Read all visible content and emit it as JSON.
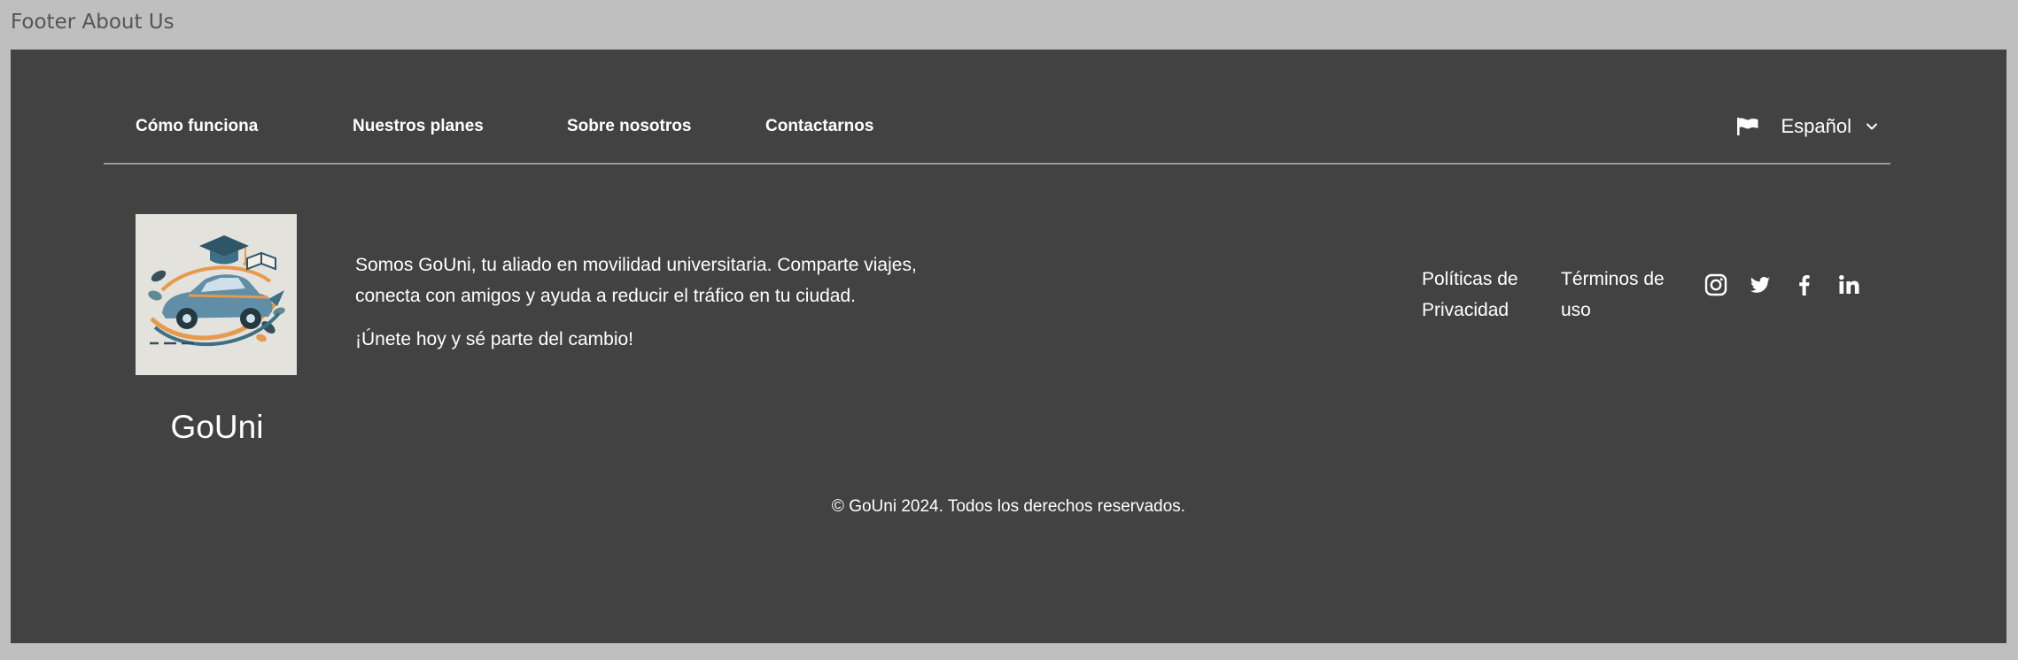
{
  "canvas": {
    "title": "Footer About Us"
  },
  "nav": {
    "items": [
      {
        "label": "Cómo funciona"
      },
      {
        "label": "Nuestros planes"
      },
      {
        "label": "Sobre nosotros"
      },
      {
        "label": "Contactarnos"
      }
    ],
    "language": {
      "icon": "flag-icon",
      "label": "Español",
      "chevron": "chevron-down-icon"
    }
  },
  "brand": {
    "name": "GoUni",
    "logo": "car-graduation-cap-logo"
  },
  "about": {
    "text": "Somos GoUni, tu aliado en movilidad universitaria. Comparte viajes, conecta con amigos y ayuda a reducir el tráfico en tu ciudad.",
    "cta": "¡Únete hoy y sé parte del cambio!"
  },
  "legal": {
    "privacy": "Políticas de Privacidad",
    "terms": "Términos de uso"
  },
  "social": [
    {
      "icon": "instagram-icon"
    },
    {
      "icon": "twitter-icon"
    },
    {
      "icon": "facebook-icon"
    },
    {
      "icon": "linkedin-icon"
    }
  ],
  "copyright": "© GoUni 2024. Todos los derechos reservados.",
  "colors": {
    "page_background": "#bfbfbf",
    "footer_background": "#424242",
    "divider": "#9a9a9a",
    "text": "#ffffff"
  }
}
